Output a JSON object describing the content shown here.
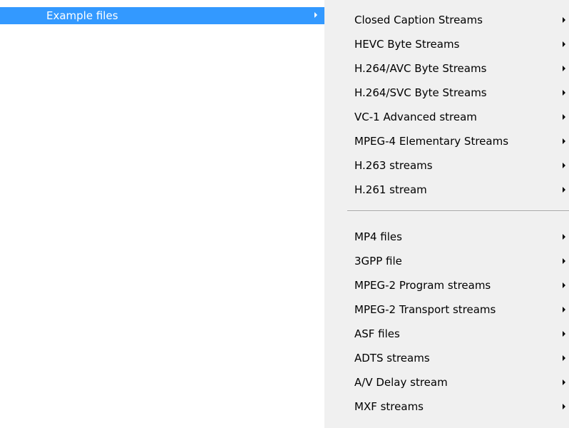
{
  "parent": {
    "label": "Example files"
  },
  "submenu": {
    "group1": [
      "Closed Caption Streams",
      "HEVC Byte Streams",
      "H.264/AVC Byte Streams",
      "H.264/SVC Byte Streams",
      "VC-1 Advanced stream",
      "MPEG-4 Elementary Streams",
      "H.263 streams",
      "H.261 stream"
    ],
    "group2": [
      "MP4 files",
      "3GPP file",
      "MPEG-2 Program streams",
      "MPEG-2 Transport streams",
      "ASF files",
      "ADTS streams",
      "A/V Delay stream",
      "MXF streams"
    ]
  },
  "colors": {
    "highlight": "#3399ff",
    "menu_bg": "#f0f0f0"
  }
}
